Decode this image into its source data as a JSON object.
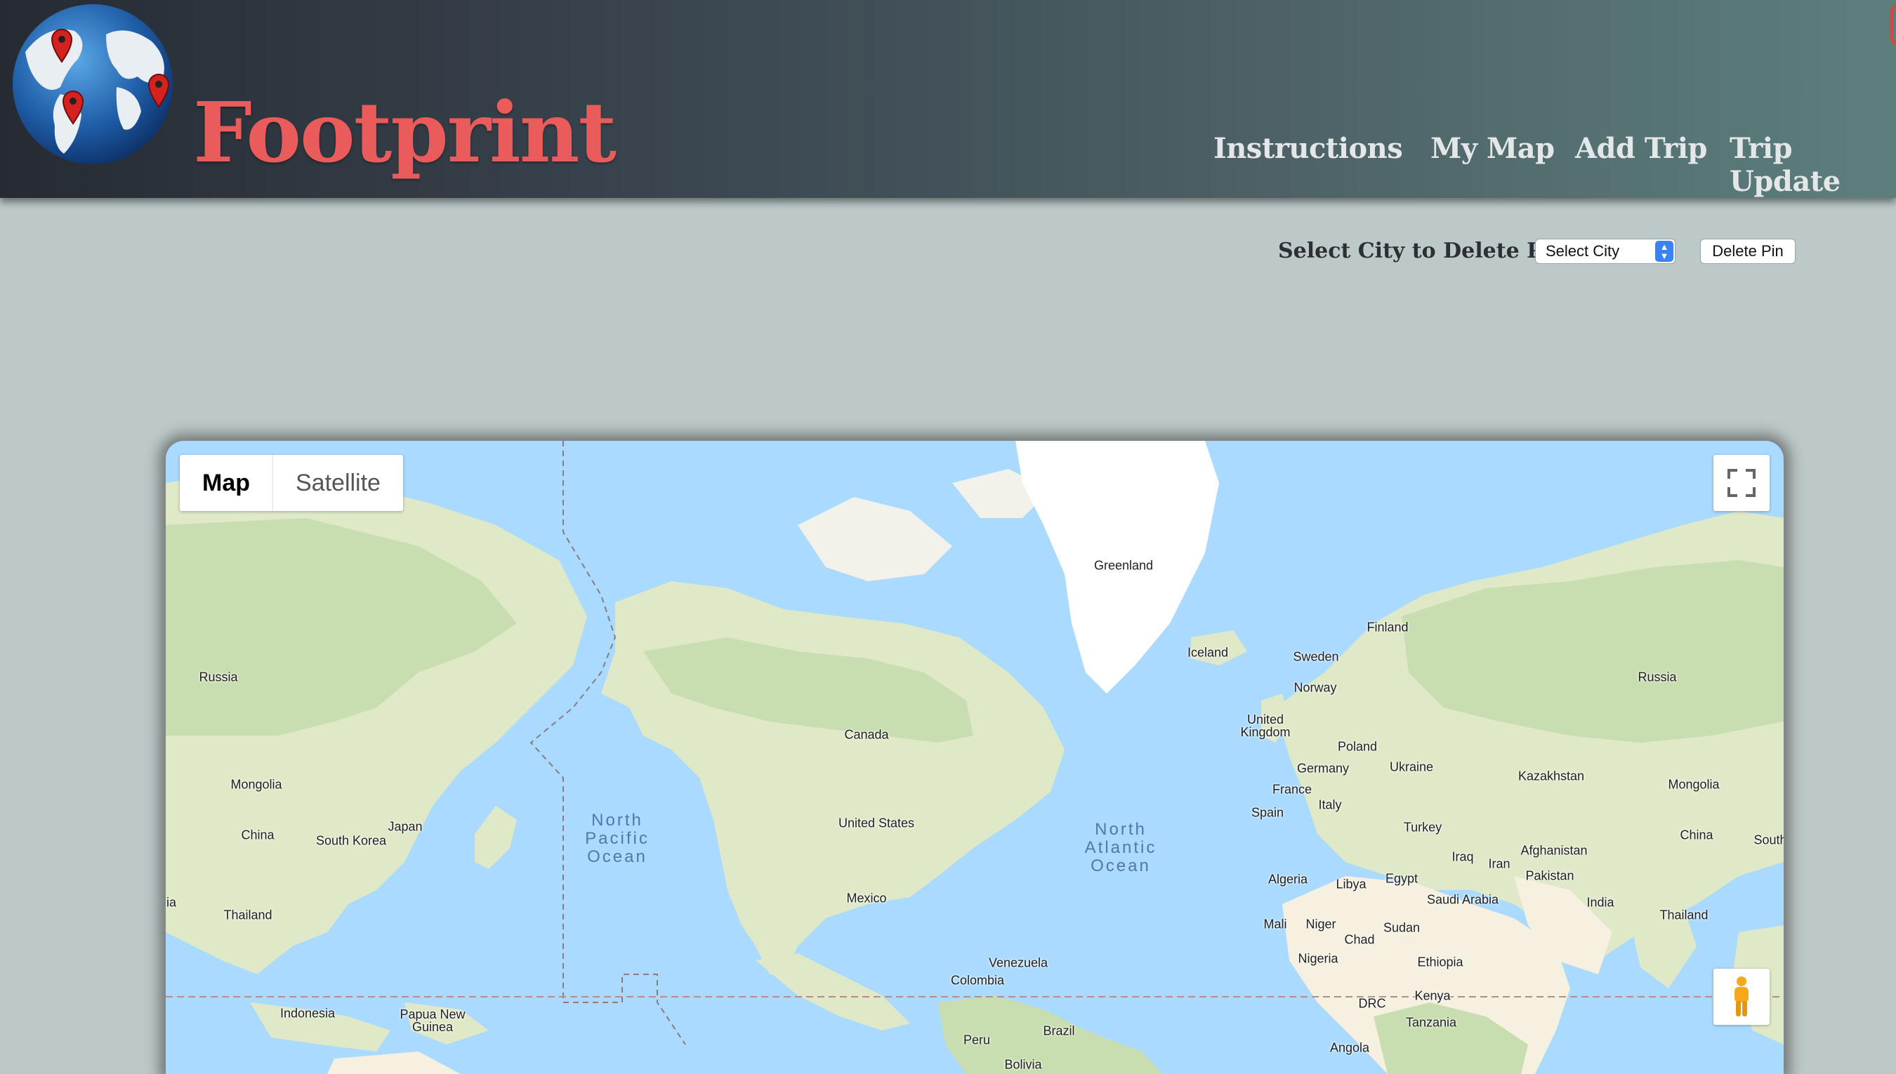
{
  "header": {
    "brand": "Footprint",
    "logo_icon": "globe-with-pins-icon",
    "nav": {
      "instructions": "Instructions",
      "my_map": "My Map",
      "add_trip": "Add Trip",
      "trip_update": "Trip Update"
    },
    "brand_color": "#ea5b5b"
  },
  "controls": {
    "delete_label": "Select City to Delete Pin:",
    "select_value": "Select City",
    "delete_button": "Delete Pin"
  },
  "map": {
    "type_buttons": {
      "map": "Map",
      "satellite": "Satellite"
    },
    "selected_type": "Map",
    "fullscreen_icon": "fullscreen-icon",
    "pegman_icon": "street-view-pegman-icon",
    "ocean_labels": {
      "north_pacific": "North\nPacific\nOcean",
      "north_atlantic": "North\nAtlantic\nOcean"
    },
    "country_labels": {
      "greenland": "Greenland",
      "iceland": "Iceland",
      "finland": "Finland",
      "sweden": "Sweden",
      "norway": "Norway",
      "united_kingdom": "United\nKingdom",
      "poland": "Poland",
      "germany": "Germany",
      "ukraine": "Ukraine",
      "france": "France",
      "italy": "Italy",
      "spain": "Spain",
      "turkey": "Turkey",
      "iraq": "Iraq",
      "iran": "Iran",
      "afghanistan": "Afghanistan",
      "pakistan": "Pakistan",
      "india": "India",
      "kazakhstan": "Kazakhstan",
      "russia_east": "Russia",
      "russia_west": "Russia",
      "mongolia_east": "Mongolia",
      "mongolia_west": "Mongolia",
      "china_east": "China",
      "china_west": "China",
      "south_partial": "South",
      "thailand_east": "Thailand",
      "thailand_west": "Thailand",
      "ia_partial": "ia",
      "japan": "Japan",
      "south_korea": "South Korea",
      "indonesia": "Indonesia",
      "papua_new_guinea": "Papua New\nGuinea",
      "canada": "Canada",
      "united_states": "United States",
      "mexico": "Mexico",
      "venezuela": "Venezuela",
      "colombia": "Colombia",
      "peru": "Peru",
      "brazil": "Brazil",
      "bolivia": "Bolivia",
      "algeria": "Algeria",
      "libya": "Libya",
      "egypt": "Egypt",
      "saudi_arabia": "Saudi Arabia",
      "mali": "Mali",
      "niger": "Niger",
      "chad": "Chad",
      "sudan": "Sudan",
      "nigeria": "Nigeria",
      "ethiopia": "Ethiopia",
      "drc": "DRC",
      "kenya": "Kenya",
      "tanzania": "Tanzania",
      "angola": "Angola"
    },
    "colors": {
      "water": "#aadaff",
      "land": "#dfe9c8",
      "forest": "#c8deb0",
      "ice": "#ffffff",
      "desert": "#f5f0e0"
    }
  }
}
